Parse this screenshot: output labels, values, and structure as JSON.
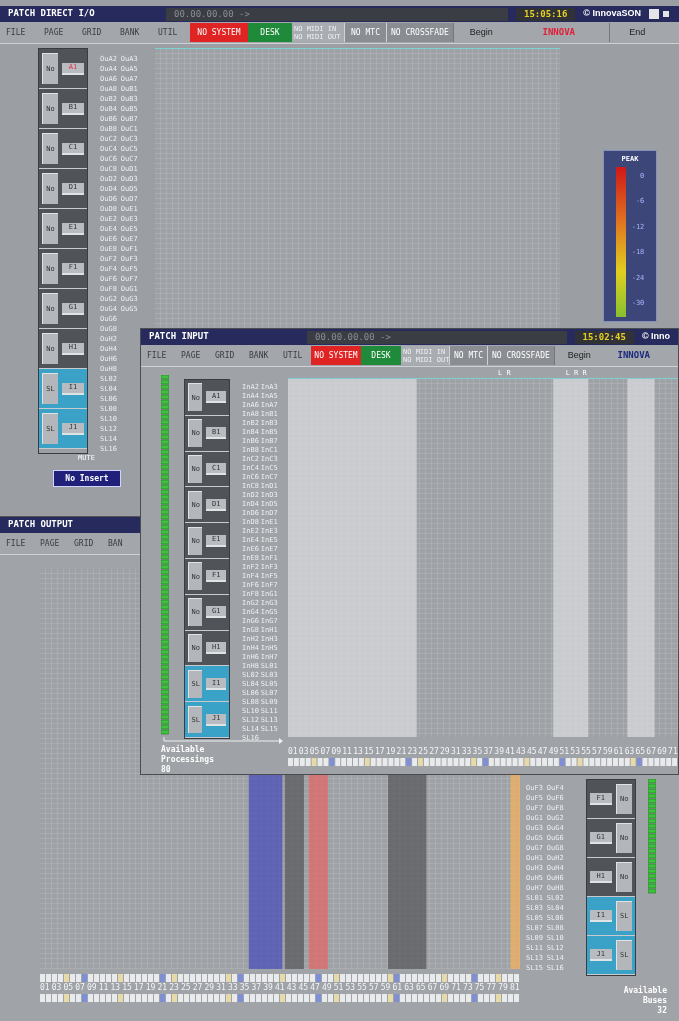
{
  "direct_io": {
    "title": "PATCH DIRECT I/O",
    "timecode": "00.00.00.00 ->",
    "clock": "15:05:16",
    "brand": "© InnovaSON",
    "menu": [
      "FILE",
      "PAGE",
      "GRID",
      "BANK",
      "UTIL"
    ],
    "status": [
      {
        "kind": "alert",
        "label": "NO SYSTEM"
      },
      {
        "kind": "ok",
        "label": "DESK"
      },
      {
        "kind": "midi",
        "lines": [
          "NO MIDI IN",
          "NO MIDI OUT"
        ]
      },
      {
        "kind": "off",
        "label": "NO MTC"
      },
      {
        "kind": "off",
        "label": "NO CROSSFADE"
      },
      {
        "kind": "text",
        "label": "Begin"
      },
      {
        "kind": "brand",
        "label": "INNOVA",
        "color": "#e0203a"
      },
      {
        "kind": "text",
        "label": "End"
      }
    ],
    "blocks": [
      {
        "kind": "no",
        "mode": "No",
        "label": "A1",
        "selected": true
      },
      {
        "kind": "no",
        "mode": "No",
        "label": "B1",
        "selected": false
      },
      {
        "kind": "no",
        "mode": "No",
        "label": "C1",
        "selected": false
      },
      {
        "kind": "no",
        "mode": "No",
        "label": "D1",
        "selected": false
      },
      {
        "kind": "no",
        "mode": "No",
        "label": "E1",
        "selected": false
      },
      {
        "kind": "no",
        "mode": "No",
        "label": "F1",
        "selected": false
      },
      {
        "kind": "no",
        "mode": "No",
        "label": "G1",
        "selected": false
      },
      {
        "kind": "no",
        "mode": "No",
        "label": "H1",
        "selected": false
      },
      {
        "kind": "sl",
        "mode": "SL",
        "label": "I1",
        "selected": false
      },
      {
        "kind": "sl",
        "mode": "SL",
        "label": "J1",
        "selected": false
      }
    ],
    "labels_left": [
      "OuA2",
      "OuA4",
      "OuA6",
      "OuA8",
      "OuB2",
      "OuB4",
      "OuB6",
      "OuB8",
      "OuC2",
      "OuC4",
      "OuC6",
      "OuC8",
      "OuD2",
      "OuD4",
      "OuD6",
      "OuD8",
      "OuE2",
      "OuE4",
      "OuE6",
      "OuE8",
      "OuF2",
      "OuF4",
      "OuF6",
      "OuF8",
      "OuG2",
      "OuG4",
      "OuG6",
      "OuG8",
      "OuH2",
      "OuH4",
      "OuH6",
      "OuH8",
      "SL02",
      "SL04",
      "SL06",
      "SL08",
      "SL10",
      "SL12",
      "SL14",
      "SL16"
    ],
    "labels_right": [
      "OuA3",
      "OuA5",
      "OuA7",
      "OuB1",
      "OuB3",
      "OuB5",
      "OuB7",
      "OuC1",
      "OuC3",
      "OuC5",
      "OuC7",
      "OuD1",
      "OuD3",
      "OuD5",
      "OuD7",
      "OuE1",
      "OuE3",
      "OuE5",
      "OuE7",
      "OuF1",
      "OuF3",
      "OuF5",
      "OuF7",
      "OuG1",
      "OuG3",
      "OuG5"
    ],
    "mute_label": "MUTE",
    "insert_button": "No Insert",
    "peak": {
      "title": "PEAK",
      "ticks": [
        "0",
        "-6",
        "-12",
        "-18",
        "-24",
        "-30"
      ]
    }
  },
  "output": {
    "title": "PATCH OUTPUT",
    "menu": [
      "FILE",
      "PAGE",
      "GRID",
      "BAN"
    ],
    "labels_left": [
      "OuF3",
      "OuF5",
      "OuF7",
      "OuG1",
      "OuG3",
      "OuG5",
      "OuG7",
      "OuH1",
      "OuH3",
      "OuH5",
      "OuH7",
      "SL01",
      "SL03",
      "SL05",
      "SL07",
      "SL09",
      "SL11",
      "SL13",
      "SL15"
    ],
    "labels_right": [
      "OuF4",
      "OuF6",
      "OuF8",
      "OuG2",
      "OuG4",
      "OuG6",
      "OuG8",
      "OuH2",
      "OuH4",
      "OuH6",
      "OuH8",
      "SL02",
      "SL04",
      "SL06",
      "SL08",
      "SL10",
      "SL12",
      "SL14",
      "SL16"
    ],
    "blocks": [
      {
        "kind": "no",
        "mode": "No",
        "label": "F1"
      },
      {
        "kind": "no",
        "mode": "No",
        "label": "G1"
      },
      {
        "kind": "no",
        "mode": "No",
        "label": "H1"
      },
      {
        "kind": "sl",
        "mode": "SL",
        "label": "I1"
      },
      {
        "kind": "sl",
        "mode": "SL",
        "label": "J1"
      }
    ],
    "available_label": "Available Buses",
    "available_count": "32",
    "channel_numbers": [
      "01",
      "03",
      "05",
      "07",
      "09",
      "11",
      "13",
      "15",
      "17",
      "19",
      "21",
      "23",
      "25",
      "27",
      "29",
      "31",
      "33",
      "35",
      "37",
      "39",
      "41",
      "43",
      "45",
      "47",
      "49",
      "51",
      "53",
      "55",
      "57",
      "59",
      "61",
      "63",
      "65",
      "67",
      "69",
      "71",
      "73",
      "75",
      "77",
      "79",
      "81"
    ]
  },
  "input": {
    "title": "PATCH INPUT",
    "timecode": "00.00.00.00 ->",
    "clock": "15:02:45",
    "brand": "© Inno",
    "menu": [
      "FILE",
      "PAGE",
      "GRID",
      "BANK",
      "UTIL"
    ],
    "status": [
      {
        "kind": "alert",
        "label": "NO SYSTEM"
      },
      {
        "kind": "ok",
        "label": "DESK"
      },
      {
        "kind": "midi",
        "lines": [
          "NO MIDI IN",
          "NO MIDI OUT"
        ]
      },
      {
        "kind": "off",
        "label": "NO MTC"
      },
      {
        "kind": "off",
        "label": "NO CROSSFADE"
      },
      {
        "kind": "text",
        "label": "Begin"
      },
      {
        "kind": "brand",
        "label": "INNOVA",
        "color": "#1c2a80"
      }
    ],
    "blocks": [
      {
        "kind": "no",
        "mode": "No",
        "label": "A1"
      },
      {
        "kind": "no",
        "mode": "No",
        "label": "B1"
      },
      {
        "kind": "no",
        "mode": "No",
        "label": "C1"
      },
      {
        "kind": "no",
        "mode": "No",
        "label": "D1"
      },
      {
        "kind": "no",
        "mode": "No",
        "label": "E1"
      },
      {
        "kind": "no",
        "mode": "No",
        "label": "F1"
      },
      {
        "kind": "no",
        "mode": "No",
        "label": "G1"
      },
      {
        "kind": "no",
        "mode": "No",
        "label": "H1"
      },
      {
        "kind": "sl",
        "mode": "SL",
        "label": "I1"
      },
      {
        "kind": "sl",
        "mode": "SL",
        "label": "J1"
      }
    ],
    "labels_left": [
      "InA2",
      "InA4",
      "InA6",
      "InA8",
      "InB2",
      "InB4",
      "InB6",
      "InB8",
      "InC2",
      "InC4",
      "InC6",
      "InC8",
      "InD2",
      "InD4",
      "InD6",
      "InD8",
      "InE2",
      "InE4",
      "InE6",
      "InE8",
      "InF2",
      "InF4",
      "InF6",
      "InF8",
      "InG2",
      "InG4",
      "InG6",
      "InG8",
      "InH2",
      "InH4",
      "InH6",
      "InH8",
      "SL02",
      "SL04",
      "SL06",
      "SL08",
      "SL10",
      "SL12",
      "SL14",
      "SL16"
    ],
    "labels_right": [
      "InA3",
      "InA5",
      "InA7",
      "InB1",
      "InB3",
      "InB5",
      "InB7",
      "InC1",
      "InC3",
      "InC5",
      "InC7",
      "InD1",
      "InD3",
      "InD5",
      "InD7",
      "InE1",
      "InE3",
      "InE5",
      "InE7",
      "InF1",
      "InF3",
      "InF5",
      "InF7",
      "InG1",
      "InG3",
      "InG5",
      "InG7",
      "InH1",
      "InH3",
      "InH5",
      "InH7",
      "SL01",
      "SL03",
      "SL05",
      "SL07",
      "SL09",
      "SL11",
      "SL13",
      "SL15"
    ],
    "grid_marks": [
      "L R",
      "L R R"
    ],
    "available_label": "Available Processings",
    "available_count": "80",
    "channel_numbers": [
      "01",
      "03",
      "05",
      "07",
      "09",
      "11",
      "13",
      "15",
      "17",
      "19",
      "21",
      "23",
      "25",
      "27",
      "29",
      "31",
      "33",
      "35",
      "37",
      "39",
      "41",
      "43",
      "45",
      "47",
      "49",
      "51",
      "53",
      "55",
      "57",
      "59",
      "61",
      "63",
      "65",
      "67",
      "69",
      "71"
    ]
  }
}
